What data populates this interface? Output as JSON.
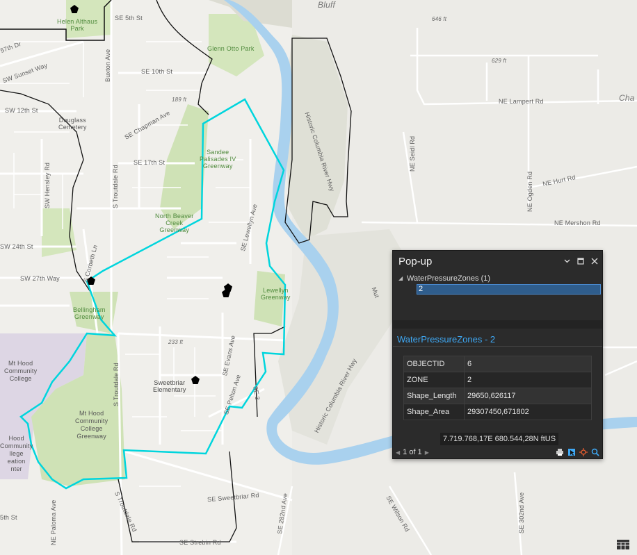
{
  "map": {
    "labels": {
      "helen_park": "Helen Althaus\nPark",
      "se5th": "SE 5th St",
      "dr57": "57th Dr",
      "sunset": "SW Sunset Way",
      "buxton": "Buxton Ave",
      "se10th": "SE 10th St",
      "glenn": "Glenn Otto Park",
      "bluff": "Bluff",
      "e646": "646 ft",
      "e629": "629 ft",
      "e189": "189 ft",
      "chapman": "SE Chapman Ave",
      "sw12th": "SW 12th St",
      "douglass": "Douglass\nCemetery",
      "lampert": "NE Lampert Rd",
      "cha": "Cha",
      "hwy_top": "Historic Columbia River Hwy",
      "seidl": "NE Seidl Rd",
      "sandee": "Sandee\nPalisades IV\nGreenway",
      "se17th": "SE 17th St",
      "hensley": "SW Hensley Rd",
      "troutdale_n": "S Troutdale Rd",
      "hurt": "NE Hurt Rd",
      "ogden": "NE Ogden Rd",
      "mershon": "NE Mershon Rd",
      "northbeaver": "North Beaver\nCreek\nGreenway",
      "lewellyn_ave": "SE Lewellyn Ave",
      "corbeth": "S Corbeth Ln",
      "sw24th": "SW 24th St",
      "sw27th": "SW 27th Way",
      "lewellyn_gw": "Lewellyn\nGreenway",
      "bellingham": "Bellingham\nGreenway",
      "e233": "233 ft",
      "mthood_cc": "Mt Hood\nCommunity\nCollege",
      "evans": "SE Evans Ave",
      "sweetbriar_el": "Sweetbriar\nElementary",
      "troutdale_s": "S Troutdale Rd",
      "pelton": "SE Pelton Ave",
      "mthood_gw": "Mt Hood\nCommunity\nCollege\nGreenway",
      "hood_rec": "Hood\nCommunity\nllege\neation\nnter",
      "hwy_bot": "Historic Columbia River Hwy",
      "mut": "Mut",
      "sweetbriar_rd": "SE Sweetbriar Rd",
      "e282": "SE 282nd Ave",
      "wilson": "SE Wilson Rd",
      "e302": "SE 302nd Ave",
      "paloma": "NE Paloma Ave",
      "sth5": "5th St",
      "strebin": "SE Strebin Rd",
      "troutdale_rd2": "S Troutdale Rd",
      "se3x": "SE 3"
    },
    "colors": {
      "land": "#ecebe7",
      "park": "#cfe2b6",
      "water": "#a9d1ee",
      "urban": "#dcd6e2",
      "zone": "#00d5dd",
      "boundary": "#111111",
      "road": "#ffffff"
    }
  },
  "popup": {
    "title": "Pop-up",
    "icons": {
      "menu": "chevron-down-icon",
      "maximize": "maximize-icon",
      "close": "close-icon"
    },
    "layer": "WaterPressureZones  (1)",
    "selected_feature": "2",
    "feature_title": "WaterPressureZones - 2",
    "fields": [
      {
        "key": "OBJECTID",
        "value": "6"
      },
      {
        "key": "ZONE",
        "value": "2"
      },
      {
        "key": "Shape_Length",
        "value": "29650,626117"
      },
      {
        "key": "Shape_Area",
        "value": "29307450,671802"
      }
    ],
    "coordinates": "7.719.768,17E 680.544,28N ftUS",
    "pager": "1 of 1"
  }
}
